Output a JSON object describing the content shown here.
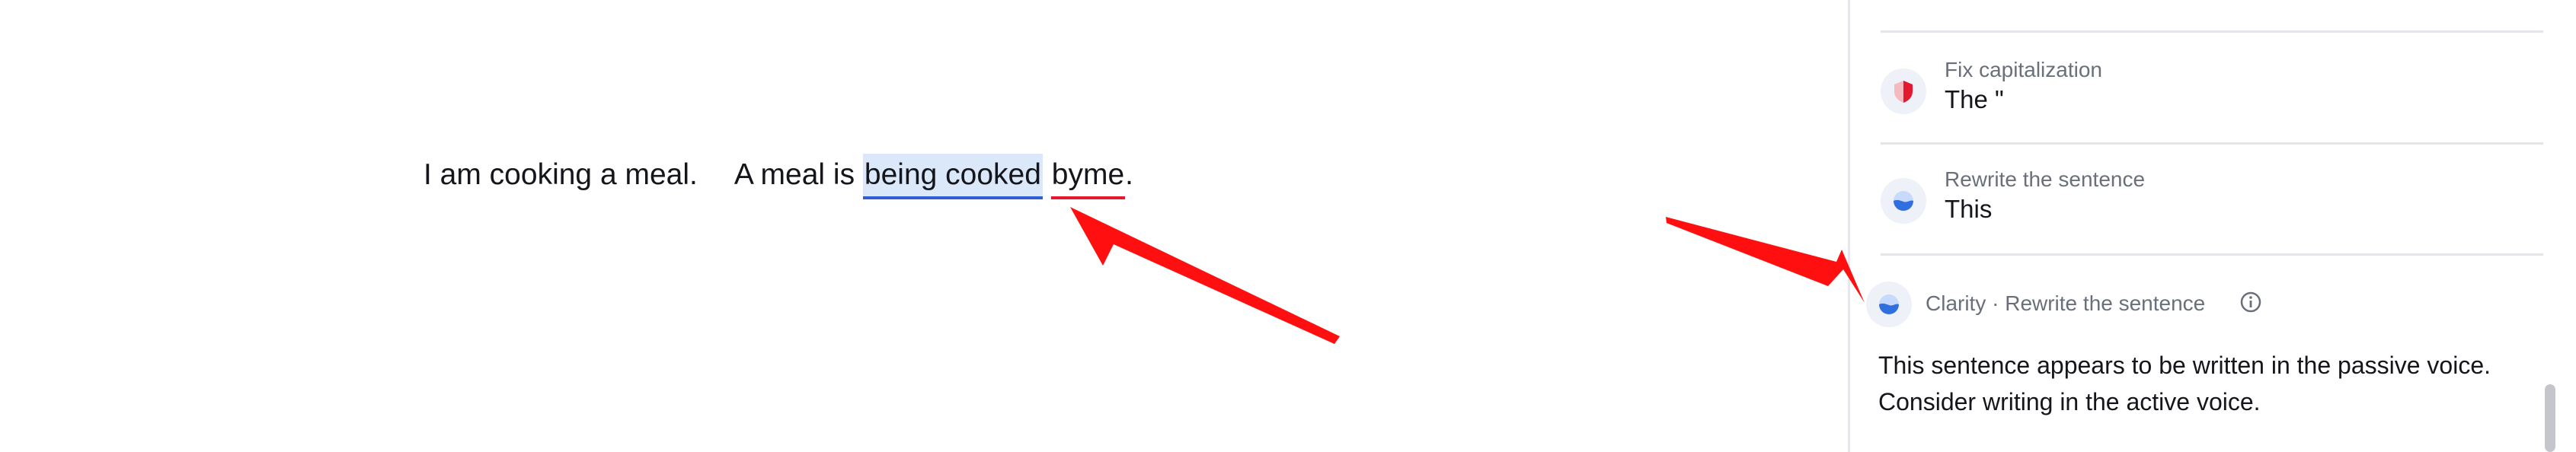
{
  "editor": {
    "sentence1": "I am cooking a meal.",
    "sentence2_start": "A meal is ",
    "passive_phrase": "being cooked",
    "misspelled_word": "byme",
    "sentence2_end": "."
  },
  "suggestions": [
    {
      "label": "Fix capitalization",
      "value": "The \"",
      "icon": "correctness-shield-icon",
      "color": "#e2192f"
    },
    {
      "label": "Rewrite the sentence",
      "value": "This",
      "icon": "clarity-icon",
      "color": "#2f6fe0"
    }
  ],
  "detail": {
    "title": "Clarity · Rewrite the sentence",
    "icon": "clarity-icon",
    "info_icon": "info-icon",
    "description": "This sentence appears to be written in the passive voice. Consider writing in the active voice."
  },
  "colors": {
    "passive_highlight": "#dbe8fa",
    "passive_underline": "#2f5fd0",
    "spelling_underline": "#e2192f",
    "annotation_arrow": "#ff0f0f"
  }
}
